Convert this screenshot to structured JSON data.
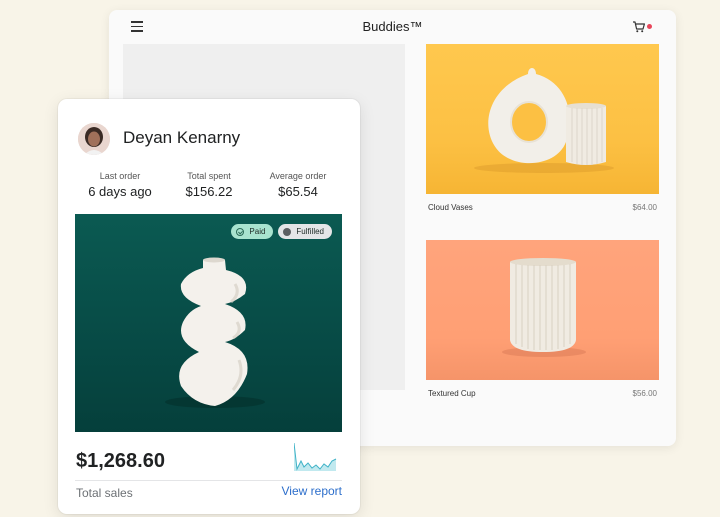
{
  "store": {
    "title": "Buddies™",
    "products": [
      {
        "name": "Cloud Vases",
        "price": "$64.00",
        "image_color": "#fcc043"
      },
      {
        "name": "Textured Cup",
        "price": "$56.00",
        "image_color": "#ffa37a"
      }
    ]
  },
  "customer": {
    "name": "Deyan Kenarny",
    "stats": [
      {
        "label": "Last order",
        "value": "6 days ago"
      },
      {
        "label": "Total spent",
        "value": "$156.22"
      },
      {
        "label": "Average order",
        "value": "$65.54"
      }
    ],
    "badges": {
      "paid": "Paid",
      "fulfilled": "Fulfilled"
    },
    "hero_color": "#074a45",
    "total_sales_value": "$1,268.60",
    "total_sales_label": "Total sales",
    "view_report": "View report"
  }
}
